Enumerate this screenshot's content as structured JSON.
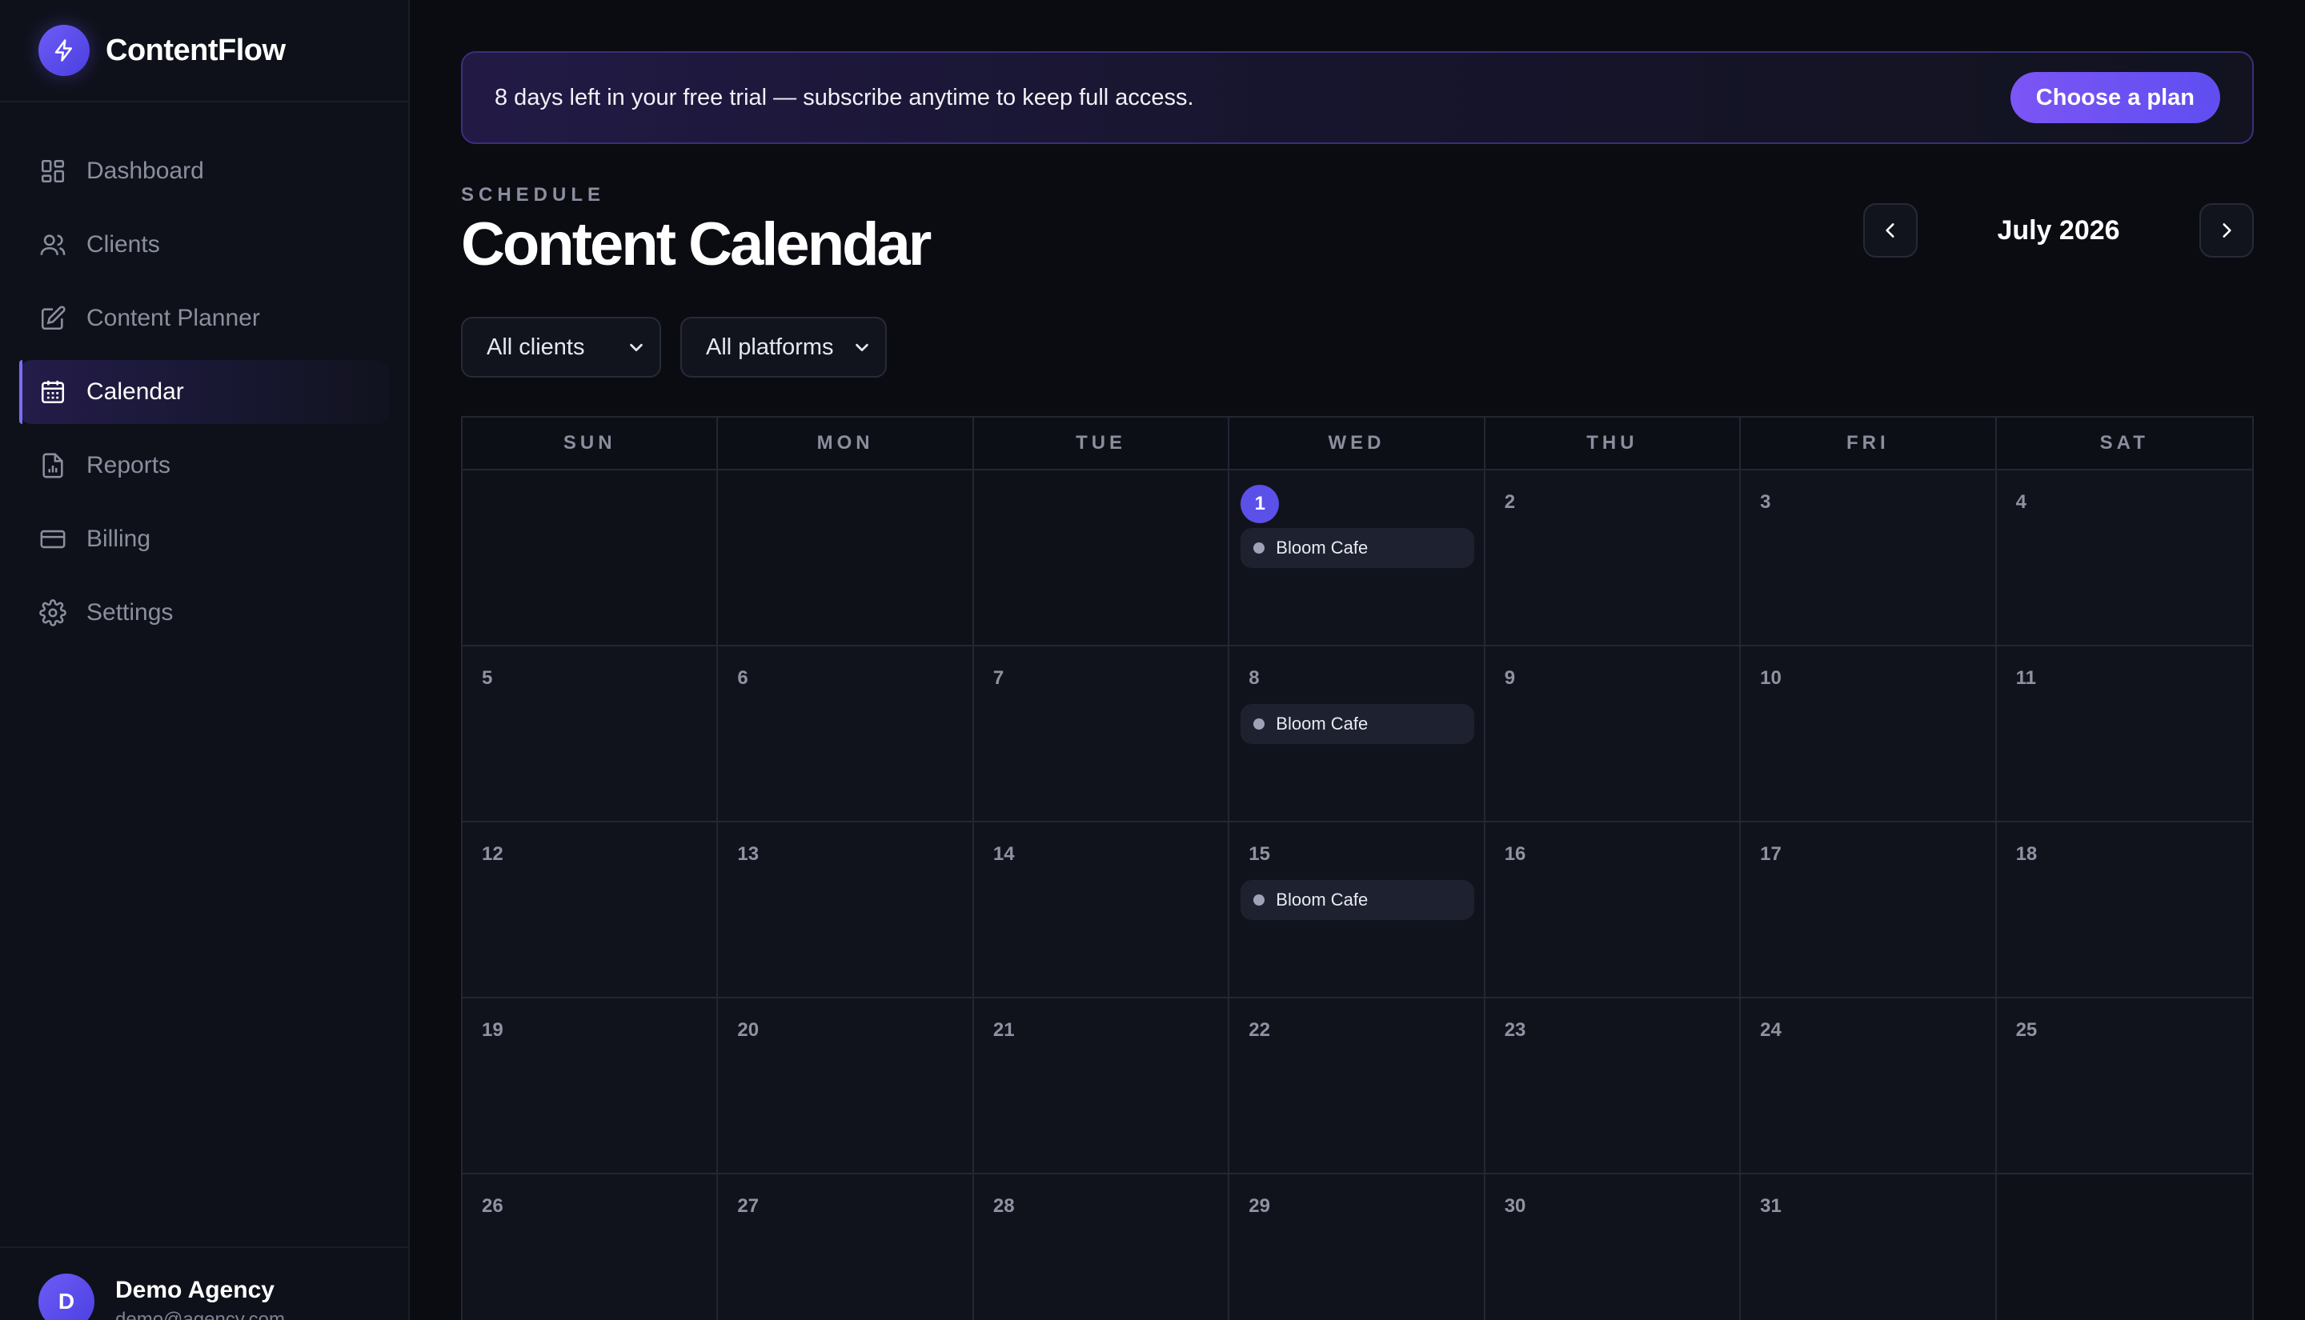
{
  "brand": {
    "name": "ContentFlow"
  },
  "sidebar": {
    "items": [
      {
        "label": "Dashboard",
        "icon": "dashboard-grid-icon",
        "active": false
      },
      {
        "label": "Clients",
        "icon": "users-icon",
        "active": false
      },
      {
        "label": "Content Planner",
        "icon": "edit-square-icon",
        "active": false
      },
      {
        "label": "Calendar",
        "icon": "calendar-icon",
        "active": true
      },
      {
        "label": "Reports",
        "icon": "report-document-icon",
        "active": false
      },
      {
        "label": "Billing",
        "icon": "credit-card-icon",
        "active": false
      },
      {
        "label": "Settings",
        "icon": "gear-icon",
        "active": false
      }
    ],
    "user": {
      "initial": "D",
      "name": "Demo Agency",
      "email": "demo@agency.com"
    }
  },
  "banner": {
    "text": "8 days left in your free trial — subscribe anytime to keep full access.",
    "button_label": "Choose a plan"
  },
  "header": {
    "eyebrow": "SCHEDULE",
    "title": "Content Calendar"
  },
  "month_nav": {
    "label": "July 2026"
  },
  "filters": {
    "client": "All clients",
    "platform": "All platforms"
  },
  "calendar": {
    "weekdays": [
      "SUN",
      "MON",
      "TUE",
      "WED",
      "THU",
      "FRI",
      "SAT"
    ],
    "days": [
      {
        "num": ""
      },
      {
        "num": ""
      },
      {
        "num": ""
      },
      {
        "num": "1",
        "today": true,
        "event": "Bloom Cafe"
      },
      {
        "num": "2"
      },
      {
        "num": "3"
      },
      {
        "num": "4"
      },
      {
        "num": "5"
      },
      {
        "num": "6"
      },
      {
        "num": "7"
      },
      {
        "num": "8",
        "event": "Bloom Cafe"
      },
      {
        "num": "9"
      },
      {
        "num": "10"
      },
      {
        "num": "11"
      },
      {
        "num": "12"
      },
      {
        "num": "13"
      },
      {
        "num": "14"
      },
      {
        "num": "15",
        "event": "Bloom Cafe"
      },
      {
        "num": "16"
      },
      {
        "num": "17"
      },
      {
        "num": "18"
      },
      {
        "num": "19"
      },
      {
        "num": "20"
      },
      {
        "num": "21"
      },
      {
        "num": "22"
      },
      {
        "num": "23"
      },
      {
        "num": "24"
      },
      {
        "num": "25"
      },
      {
        "num": "26"
      },
      {
        "num": "27"
      },
      {
        "num": "28"
      },
      {
        "num": "29"
      },
      {
        "num": "30"
      },
      {
        "num": "31"
      },
      {
        "num": ""
      }
    ]
  },
  "colors": {
    "accent": "#5b50e8",
    "background": "#0b0c12",
    "sidebar": "#0f111a"
  }
}
